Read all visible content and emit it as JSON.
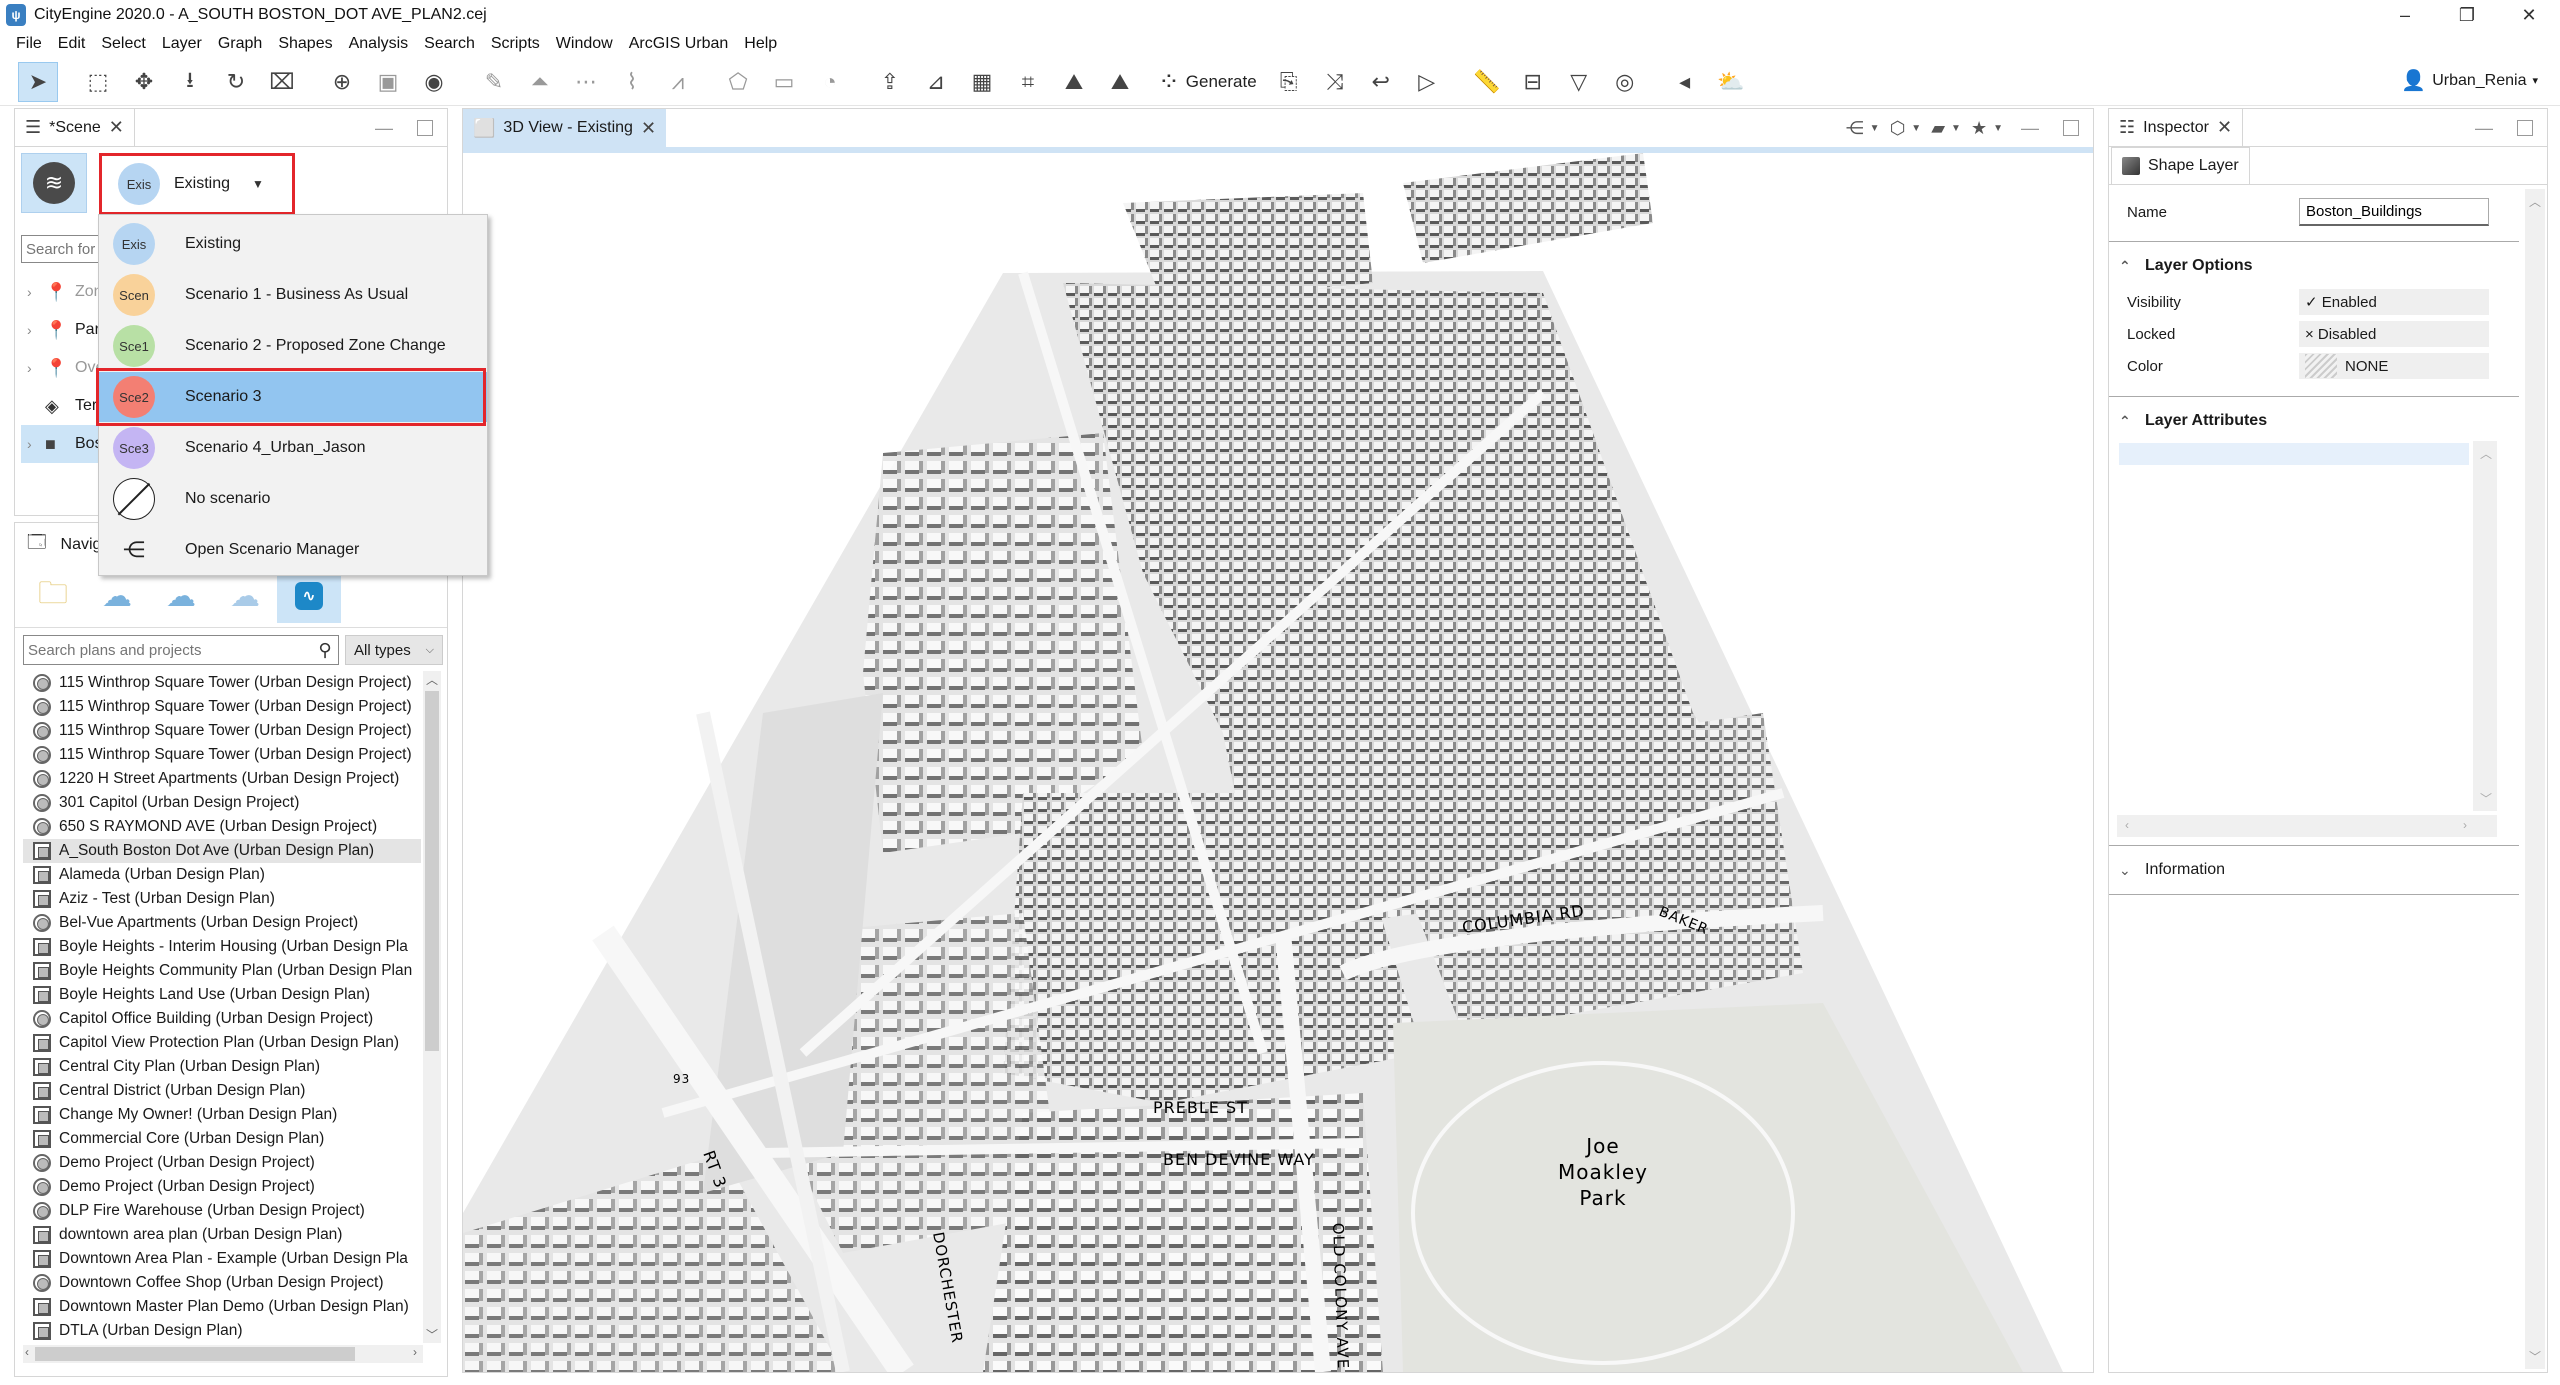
{
  "window": {
    "title": "CityEngine 2020.0 - A_SOUTH BOSTON_DOT AVE_PLAN2.cej",
    "controls": {
      "minimize": "–",
      "restore": "❐",
      "close": "✕"
    }
  },
  "menubar": [
    "File",
    "Edit",
    "Select",
    "Layer",
    "Graph",
    "Shapes",
    "Analysis",
    "Search",
    "Scripts",
    "Window",
    "ArcGIS Urban",
    "Help"
  ],
  "toolbar": {
    "generate_label": "Generate",
    "user_label": "Urban_Renia",
    "user_caret": "▾",
    "tools": [
      {
        "name": "select-tool",
        "glyph": "➤",
        "active": true
      },
      {
        "name": "frame-tool",
        "glyph": "⬚"
      },
      {
        "name": "move-tool",
        "glyph": "✥"
      },
      {
        "name": "drop-tool",
        "glyph": "⭳"
      },
      {
        "name": "rotate-tool",
        "glyph": "↻"
      },
      {
        "name": "scale-tool",
        "glyph": "⌧"
      },
      {
        "name": "orbit-tool",
        "glyph": "⊕"
      },
      {
        "name": "align-tool",
        "glyph": "▣",
        "grey": true
      },
      {
        "name": "frame-rotate-tool",
        "glyph": "◉"
      },
      {
        "name": "polygon-street-tool",
        "glyph": "✎",
        "grey": true
      },
      {
        "name": "street-select-tool",
        "glyph": "⏶",
        "grey": true
      },
      {
        "name": "street-split-tool",
        "glyph": "⋯",
        "grey": true
      },
      {
        "name": "street-clean-tool",
        "glyph": "⌇",
        "grey": true
      },
      {
        "name": "street-terrain-tool",
        "glyph": "⩘",
        "grey": true
      },
      {
        "name": "polygon-shape-tool",
        "glyph": "⬠",
        "grey": true
      },
      {
        "name": "rectangle-shape-tool",
        "glyph": "▭",
        "grey": true
      },
      {
        "name": "circle-shape-tool",
        "glyph": "◔",
        "grey": true
      },
      {
        "name": "extrude-tool",
        "glyph": "⇪"
      },
      {
        "name": "measure-angle-tool",
        "glyph": "⊿"
      },
      {
        "name": "texture-tool",
        "glyph": "▦"
      },
      {
        "name": "paint-tool",
        "glyph": "⌗"
      },
      {
        "name": "align-terrain-tool",
        "glyph": "⛰"
      },
      {
        "name": "align-shapes-tool",
        "glyph": "⛰"
      }
    ],
    "tools_after": [
      {
        "name": "cga-assign-tool",
        "glyph": "⎘"
      },
      {
        "name": "shuffle-tool",
        "glyph": "⤨"
      },
      {
        "name": "reset-tool",
        "glyph": "↩"
      },
      {
        "name": "pointer-tool",
        "glyph": "▷"
      },
      {
        "name": "distance-ruler-tool",
        "glyph": "📏"
      },
      {
        "name": "area-ruler-tool",
        "glyph": "⊟"
      },
      {
        "name": "height-tool",
        "glyph": "▽"
      },
      {
        "name": "visibility-tool",
        "glyph": "◎"
      },
      {
        "name": "viewshed-tool",
        "glyph": "◂"
      },
      {
        "name": "light-settings-tool",
        "glyph": "⛅"
      }
    ]
  },
  "scene_panel": {
    "tab_label": "*Scene",
    "close_glyph": "✕",
    "selected_scenario": {
      "badge": "Exis",
      "label": "Existing",
      "color": "#b6d5f2"
    },
    "search_placeholder": "Search for",
    "tree": [
      {
        "label": "Zon",
        "icon": "pin",
        "expandable": true,
        "dim": true
      },
      {
        "label": "Parc",
        "icon": "pin",
        "expandable": true,
        "dim": false
      },
      {
        "label": "Ove",
        "icon": "pin",
        "expandable": true,
        "dim": true
      },
      {
        "label": "Terr",
        "icon": "terrain",
        "expandable": false,
        "dim": false
      },
      {
        "label": "Bos",
        "icon": "cube",
        "expandable": true,
        "dim": false,
        "selected": true
      }
    ]
  },
  "scenario_dropdown": {
    "items": [
      {
        "badge": "Exis",
        "label": "Existing",
        "color": "#b6d5f2"
      },
      {
        "badge": "Scen",
        "label": "Scenario 1 - Business As Usual",
        "color": "#f9d29a"
      },
      {
        "badge": "Sce1",
        "label": "Scenario 2 - Proposed Zone Change",
        "color": "#b8e0a5"
      },
      {
        "badge": "Sce2",
        "label": "Scenario 3",
        "color": "#f37f73",
        "highlighted": true
      },
      {
        "badge": "Sce3",
        "label": "Scenario 4_Urban_Jason",
        "color": "#c4b5f3"
      },
      {
        "badge": "",
        "label": "No scenario",
        "icon": "no-scenario"
      },
      {
        "badge": "",
        "label": "Open Scenario Manager",
        "icon": "scenario-manager"
      }
    ],
    "highlight_border_color": "#e3262b",
    "highlight_fill_color": "#92c5f0"
  },
  "navigator_panel": {
    "tab_label": "Navig",
    "sources": [
      "local-folder",
      "my-content",
      "group-content",
      "portal",
      "arcgis-urban"
    ],
    "search_placeholder": "Search plans and projects",
    "type_filter": "All types",
    "items": [
      {
        "label": "115 Winthrop Square Tower (Urban Design Project)",
        "type": "project"
      },
      {
        "label": "115 Winthrop Square Tower (Urban Design Project)",
        "type": "project"
      },
      {
        "label": "115 Winthrop Square Tower (Urban Design Project)",
        "type": "project"
      },
      {
        "label": "115 Winthrop Square Tower (Urban Design Project)",
        "type": "project"
      },
      {
        "label": "1220 H Street Apartments (Urban Design Project)",
        "type": "project"
      },
      {
        "label": "301 Capitol (Urban Design Project)",
        "type": "project"
      },
      {
        "label": "650 S RAYMOND AVE (Urban Design Project)",
        "type": "project"
      },
      {
        "label": "A_South Boston Dot Ave (Urban Design Plan)",
        "type": "plan",
        "selected": true
      },
      {
        "label": "Alameda (Urban Design Plan)",
        "type": "plan"
      },
      {
        "label": "Aziz - Test (Urban Design Plan)",
        "type": "plan"
      },
      {
        "label": "Bel-Vue Apartments (Urban Design Project)",
        "type": "project"
      },
      {
        "label": "Boyle Heights - Interim Housing (Urban Design Pla",
        "type": "plan"
      },
      {
        "label": "Boyle Heights Community Plan (Urban Design Plan",
        "type": "plan"
      },
      {
        "label": "Boyle Heights Land Use (Urban Design Plan)",
        "type": "plan"
      },
      {
        "label": "Capitol Office Building (Urban Design Project)",
        "type": "project"
      },
      {
        "label": "Capitol View Protection Plan (Urban Design Plan)",
        "type": "plan"
      },
      {
        "label": "Central City Plan (Urban Design Plan)",
        "type": "plan"
      },
      {
        "label": "Central District (Urban Design Plan)",
        "type": "plan"
      },
      {
        "label": "Change My Owner! (Urban Design Plan)",
        "type": "plan"
      },
      {
        "label": "Commercial Core (Urban Design Plan)",
        "type": "plan"
      },
      {
        "label": "Demo Project (Urban Design Project)",
        "type": "project"
      },
      {
        "label": "Demo Project (Urban Design Project)",
        "type": "project"
      },
      {
        "label": "DLP Fire Warehouse (Urban Design Project)",
        "type": "project"
      },
      {
        "label": "downtown area plan (Urban Design Plan)",
        "type": "plan"
      },
      {
        "label": "Downtown Area Plan - Example (Urban Design Pla",
        "type": "plan"
      },
      {
        "label": "Downtown Coffee Shop (Urban Design Project)",
        "type": "project"
      },
      {
        "label": "Downtown Master Plan Demo (Urban Design Plan)",
        "type": "plan"
      },
      {
        "label": "DTLA (Urban Design Plan)",
        "type": "plan"
      }
    ]
  },
  "view_panel": {
    "tab_label": "3D View - Existing",
    "close_glyph": "✕",
    "view_tools": [
      {
        "name": "bookmarks",
        "glyph": "⋲"
      },
      {
        "name": "scene-display",
        "glyph": "⬡"
      },
      {
        "name": "camera",
        "glyph": "▰"
      },
      {
        "name": "favorites",
        "glyph": "★"
      }
    ],
    "map_labels": [
      "COLUMBIA RD",
      "BAKER",
      "Joe",
      "Moakley",
      "Park",
      "PREBLE ST",
      "BEN DEVINE WAY",
      "OLD COLONY AVE",
      "DORCHESTER",
      "RT 3",
      "93"
    ]
  },
  "inspector_panel": {
    "tab_label": "Inspector",
    "close_glyph": "✕",
    "subtab_label": "Shape Layer",
    "name_label": "Name",
    "name_value": "Boston_Buildings",
    "layer_options_title": "Layer Options",
    "options": [
      {
        "label": "Visibility",
        "value": "✓ Enabled"
      },
      {
        "label": "Locked",
        "value": "× Disabled"
      },
      {
        "label": "Color",
        "value": "NONE",
        "swatch": "hatched"
      }
    ],
    "layer_attributes_title": "Layer Attributes",
    "information_title": "Information"
  }
}
